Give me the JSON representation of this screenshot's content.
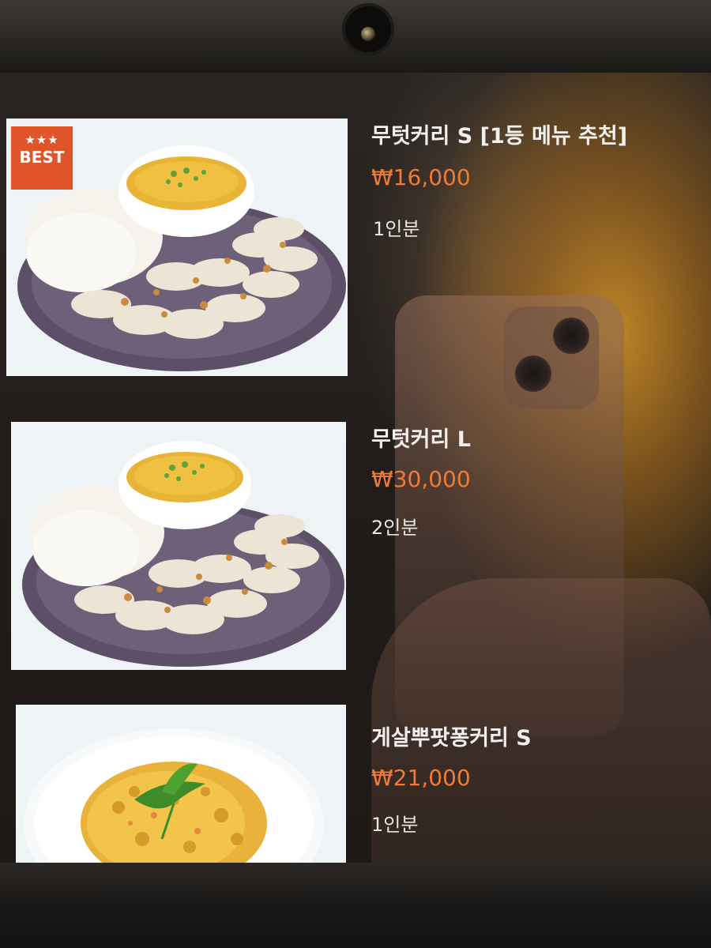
{
  "menu": {
    "items": [
      {
        "name": "무텃커리 S [1등 메뉴 추천]",
        "price": "₩16,000",
        "serving": "1인분",
        "badge": {
          "stars": "★★★",
          "label": "BEST"
        },
        "image": "curry-rice-pork-plate"
      },
      {
        "name": "무텃커리 L",
        "price": "₩30,000",
        "serving": "2인분",
        "image": "curry-rice-pork-plate"
      },
      {
        "name": "게살뿌팟퐁커리 S",
        "price": "₩21,000",
        "serving": "1인분",
        "image": "crab-curry-plate"
      }
    ]
  },
  "colors": {
    "price": "#f07a36",
    "badge": "#e0542a",
    "text": "#f2f0ee"
  }
}
